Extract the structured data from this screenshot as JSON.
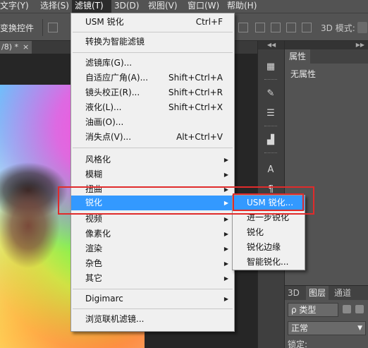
{
  "menubar": {
    "items": [
      "文字(Y)",
      "选择(S)",
      "滤镜(T)",
      "3D(D)",
      "视图(V)",
      "窗口(W)",
      "帮助(H)"
    ],
    "active_index": 2
  },
  "options": {
    "transform_label": "变换控件",
    "mode3d_label": "3D 模式:"
  },
  "document": {
    "tab_label": "/8) *",
    "close_symbol": "×"
  },
  "filter_menu": {
    "items": [
      {
        "label": "USM 锐化",
        "shortcut": "Ctrl+F"
      },
      {
        "label": "转换为智能滤镜",
        "shortcut": ""
      },
      {
        "label": "滤镜库(G)...",
        "shortcut": ""
      },
      {
        "label": "自适应广角(A)...",
        "shortcut": "Shift+Ctrl+A"
      },
      {
        "label": "镜头校正(R)...",
        "shortcut": "Shift+Ctrl+R"
      },
      {
        "label": "液化(L)...",
        "shortcut": "Shift+Ctrl+X"
      },
      {
        "label": "油画(O)...",
        "shortcut": ""
      },
      {
        "label": "消失点(V)...",
        "shortcut": "Alt+Ctrl+V"
      },
      {
        "label": "风格化",
        "submenu": true
      },
      {
        "label": "模糊",
        "submenu": true
      },
      {
        "label": "扭曲",
        "submenu": true
      },
      {
        "label": "锐化",
        "submenu": true,
        "highlighted": true
      },
      {
        "label": "视频",
        "submenu": true
      },
      {
        "label": "像素化",
        "submenu": true
      },
      {
        "label": "渲染",
        "submenu": true
      },
      {
        "label": "杂色",
        "submenu": true
      },
      {
        "label": "其它",
        "submenu": true
      },
      {
        "label": "Digimarc",
        "submenu": true
      },
      {
        "label": "浏览联机滤镜...",
        "shortcut": ""
      }
    ],
    "submenu_arrow": "▶"
  },
  "sharpen_submenu": {
    "items": [
      {
        "label": "USM 锐化...",
        "highlighted": true
      },
      {
        "label": "进一步锐化"
      },
      {
        "label": "锐化"
      },
      {
        "label": "锐化边缘"
      },
      {
        "label": "智能锐化..."
      }
    ]
  },
  "properties_panel": {
    "tab_label": "属性",
    "empty_text": "无属性"
  },
  "layers_panel": {
    "tabs": [
      "3D",
      "图层",
      "通道"
    ],
    "active_tab": "图层",
    "kind_label": "ρ 类型",
    "blend_mode": "正常",
    "lock_label": "锁定:"
  },
  "colors": {
    "highlight": "#3399ff",
    "annotation_red": "#e02b2b",
    "menu_bg": "#f0f0f0",
    "chrome_bg": "#535353"
  }
}
